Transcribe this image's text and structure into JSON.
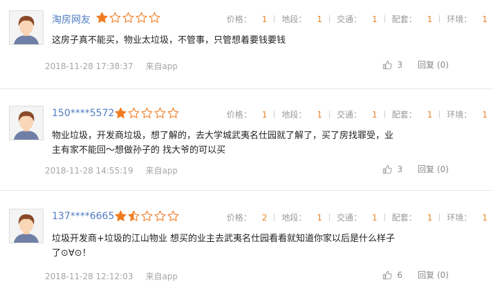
{
  "icons": {
    "avatar": "default-avatar-icon",
    "star": "star-icon",
    "like": "thumbs-up-icon"
  },
  "colors": {
    "username": "#4f7cc0",
    "star_filled": "#f07c22",
    "score_value": "#e8842a"
  },
  "score_labels": [
    "价格：",
    "地段：",
    "交通：",
    "配套：",
    "环境："
  ],
  "reviews": [
    {
      "username": "淘房网友",
      "rating": 1,
      "scores": [
        "1",
        "1",
        "1",
        "1",
        "1"
      ],
      "content": "这房子真不能买，物业太垃圾，不管事，只管想着要钱要钱",
      "date": "2018-11-28 17:38:37",
      "source": "来自app",
      "likes": "3",
      "reply": "回复 (0)"
    },
    {
      "username": "150****5572",
      "rating": 1,
      "scores": [
        "1",
        "1",
        "1",
        "1",
        "1"
      ],
      "content": "物业垃圾，开发商垃圾，想了解的，去大学城武夷名仕园就了解了，买了房找罪受，业主有家不能回～想做孙子的 找大爷的可以买",
      "date": "2018-11-28 14:55:19",
      "source": "来自app",
      "likes": "3",
      "reply": "回复 (0)"
    },
    {
      "username": "137****6665",
      "rating": 1.5,
      "scores": [
        "2",
        "1",
        "1",
        "1",
        "1"
      ],
      "content": "垃圾开发商+垃圾的江山物业 想买的业主去武夷名仕园看看就知道你家以后是什么样子了⊙∀⊙！",
      "date": "2018-11-28 12:12:03",
      "source": "来自app",
      "likes": "6",
      "reply": "回复 (0)"
    }
  ]
}
